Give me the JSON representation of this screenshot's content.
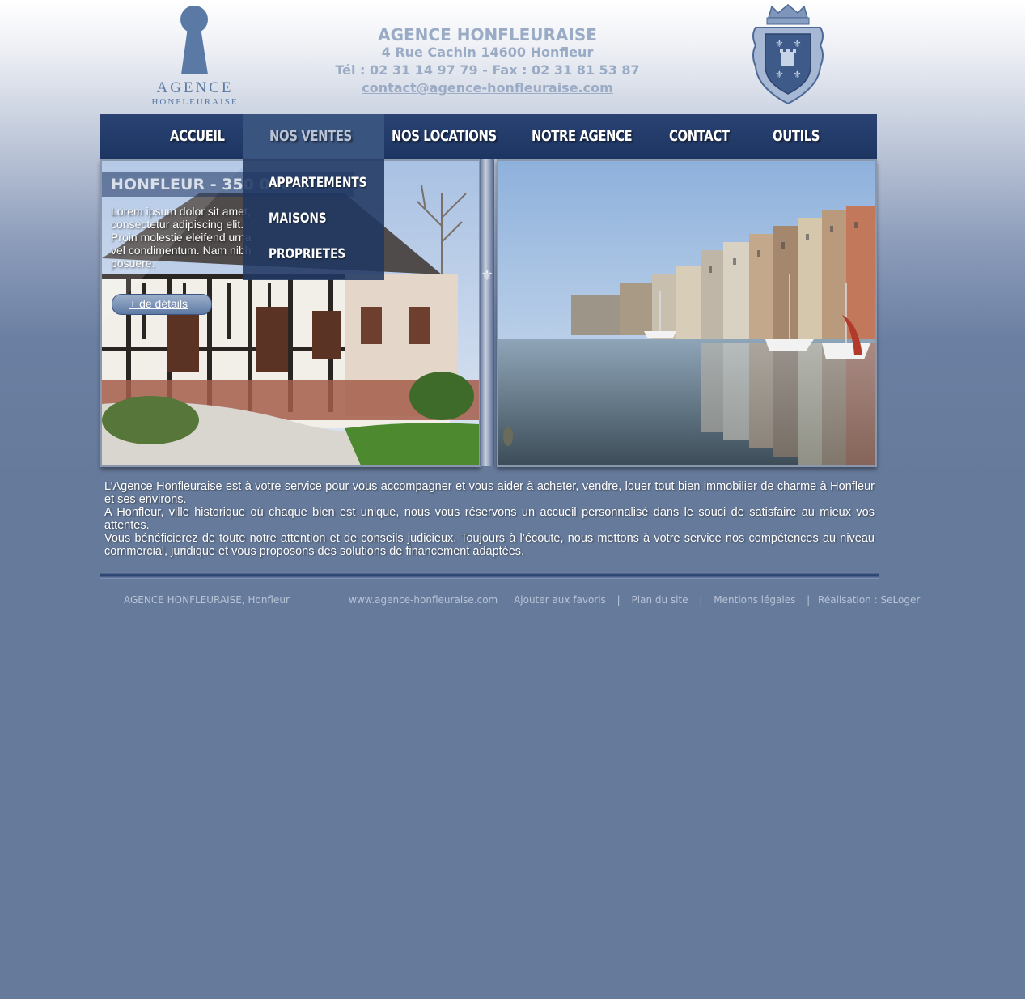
{
  "header": {
    "logo_word1": "AGENCE",
    "logo_word2": "HONFLEURAISE",
    "agency_name": "AGENCE HONFLEURAISE",
    "address": "4 Rue Cachin 14600 Honfleur",
    "phone_fax": "Tél : 02 31 14 97 79 - Fax : 02 31 81 53 87",
    "email": "contact@agence-honfleuraise.com"
  },
  "nav": {
    "items": [
      {
        "label": "ACCUEIL"
      },
      {
        "label": "NOS VENTES"
      },
      {
        "label": "NOS LOCATIONS"
      },
      {
        "label": "NOTRE AGENCE"
      },
      {
        "label": "CONTACT"
      },
      {
        "label": "OUTILS"
      }
    ],
    "dropdown": [
      {
        "label": "APPARTEMENTS"
      },
      {
        "label": "MAISONS"
      },
      {
        "label": "PROPRIETES"
      }
    ]
  },
  "listing": {
    "title": "HONFLEUR - 350 000 €",
    "text": "Lorem ipsum dolor sit amet, consectetur adipiscing elit. Proin molestie eleifend urna vel condimentum. Nam nibh posuere.",
    "button": "+ de détails"
  },
  "about": {
    "p1": "L’Agence Honfleuraise est à votre service pour vous accompagner et vous aider à acheter, vendre, louer tout bien immobilier de charme à Honfleur et ses environs.",
    "p2": "A Honfleur, ville historique où chaque bien est unique, nous vous réservons un accueil personnalisé dans le souci de satisfaire au mieux vos attentes.",
    "p3": "Vous bénéficierez de toute notre attention et de conseils judicieux. Toujours à l’écoute, nous mettons à votre service nos compétences au niveau commercial, juridique et vous proposons des solutions de financement adaptées."
  },
  "footer": {
    "brand": "AGENCE HONFLEURAISE",
    "city": ", Honfleur",
    "site": "www.agence-honfleuraise.com",
    "favorites": "Ajouter aux favoris",
    "sitemap": "Plan du site",
    "legal": "Mentions légales",
    "credit": "Réalisation : SeLoger",
    "separator": "|"
  },
  "colors": {
    "nav_bg": "#1d3562",
    "page_bg": "#667a9b",
    "header_text": "#9aabc5"
  }
}
